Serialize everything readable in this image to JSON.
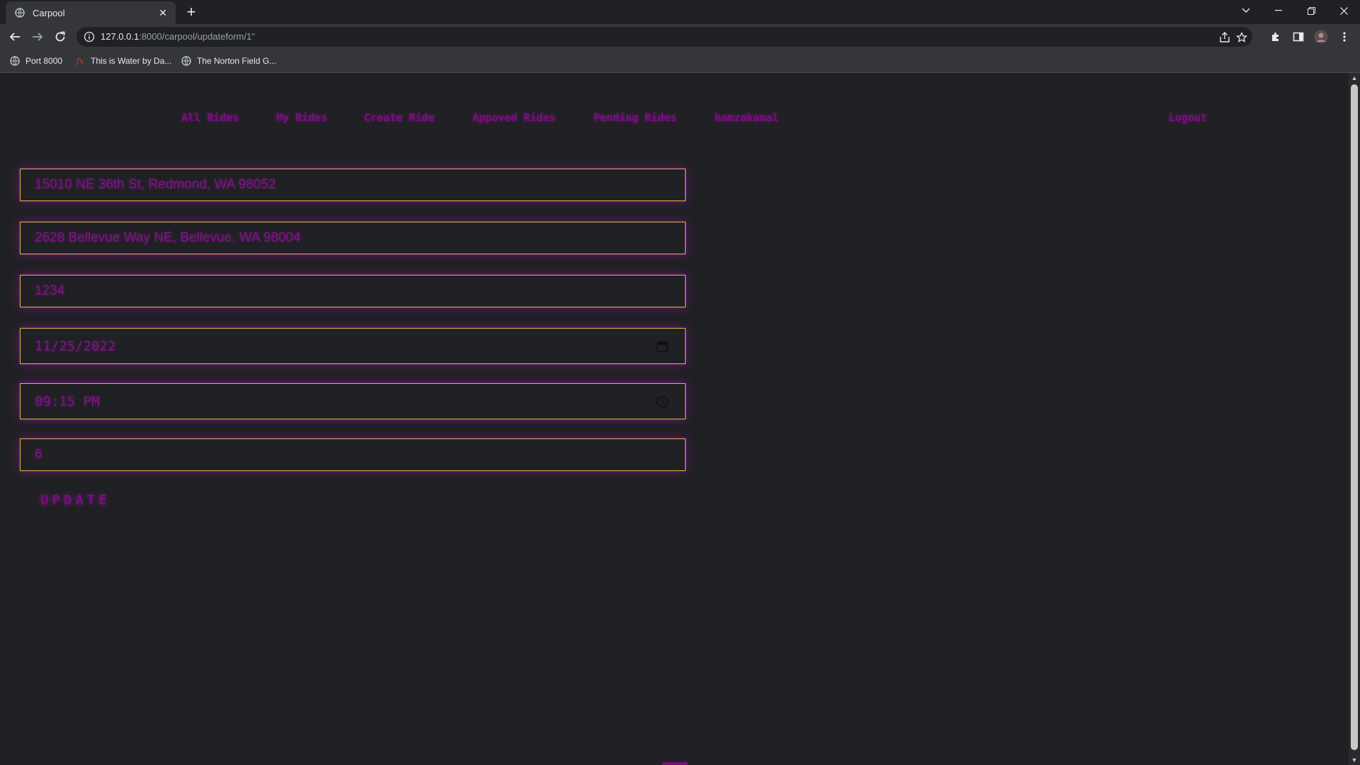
{
  "browser": {
    "tab_title": "Carpool",
    "url_host": "127.0.0.1",
    "url_rest": ":8000/carpool/updateform/1\"",
    "bookmarks": [
      {
        "label": "Port 8000"
      },
      {
        "label": "This is Water by Da..."
      },
      {
        "label": "The Norton Field G..."
      }
    ]
  },
  "nav": {
    "items": [
      "All Rides",
      "My Rides",
      "Create Ride",
      "Appoved Rides",
      "Pending Rides",
      "hamzakamal"
    ],
    "logout": "Logout"
  },
  "form": {
    "pickup": "15010 NE 36th St, Redmond, WA 98052",
    "dropoff": "2628 Bellevue Way NE, Bellevue, WA 98004",
    "code": "1234",
    "date": "11/25/2022",
    "time": "09:15 PM",
    "seats": "6",
    "submit_label": "UPDATE"
  },
  "colors": {
    "page_bg": "#202124",
    "accent_text": "#7a0e7f",
    "field_border": "#d9b24a"
  }
}
